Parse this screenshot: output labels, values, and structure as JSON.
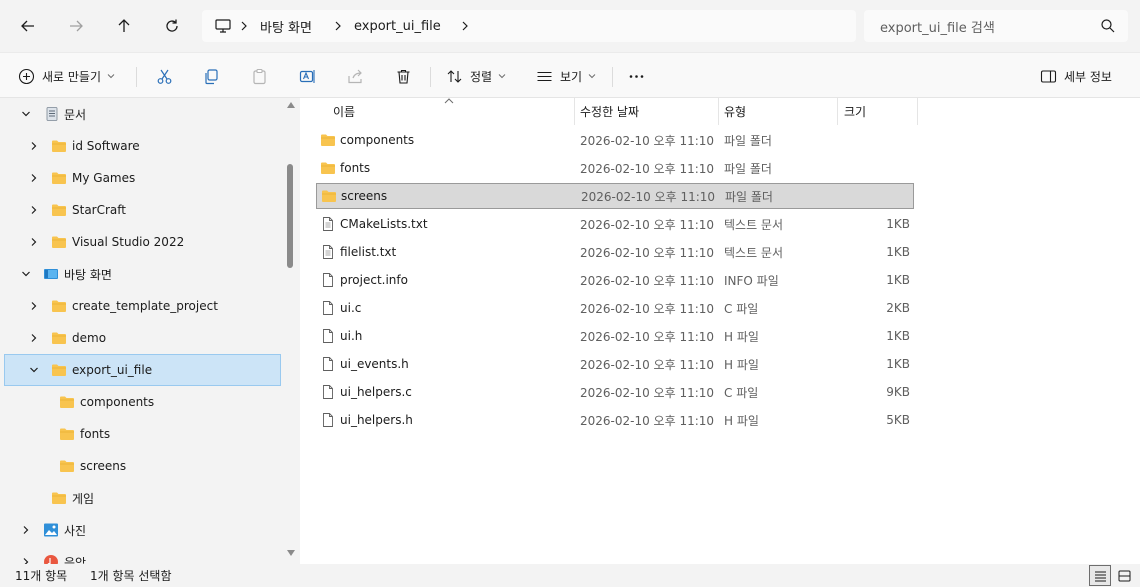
{
  "address": {
    "crumbs": [
      "바탕 화면",
      "export_ui_file"
    ]
  },
  "search": {
    "placeholder": "export_ui_file 검색"
  },
  "toolbar": {
    "new_label": "새로 만들기",
    "sort_label": "정렬",
    "view_label": "보기",
    "details_label": "세부 정보"
  },
  "nav": {
    "items": [
      {
        "label": "문서"
      },
      {
        "label": "id Software"
      },
      {
        "label": "My Games"
      },
      {
        "label": "StarCraft"
      },
      {
        "label": "Visual Studio 2022"
      },
      {
        "label": "바탕 화면"
      },
      {
        "label": "create_template_project"
      },
      {
        "label": "demo"
      },
      {
        "label": "export_ui_file"
      },
      {
        "label": "components"
      },
      {
        "label": "fonts"
      },
      {
        "label": "screens"
      },
      {
        "label": "게임"
      },
      {
        "label": "사진"
      },
      {
        "label": "음악"
      }
    ]
  },
  "columns": {
    "name": "이름",
    "modified": "수정한 날짜",
    "type": "유형",
    "size": "크기"
  },
  "files": [
    {
      "name": "components",
      "modified": "2026-02-10 오후 11:10",
      "type": "파일 폴더",
      "size": ""
    },
    {
      "name": "fonts",
      "modified": "2026-02-10 오후 11:10",
      "type": "파일 폴더",
      "size": ""
    },
    {
      "name": "screens",
      "modified": "2026-02-10 오후 11:10",
      "type": "파일 폴더",
      "size": ""
    },
    {
      "name": "CMakeLists.txt",
      "modified": "2026-02-10 오후 11:10",
      "type": "텍스트 문서",
      "size": "1KB"
    },
    {
      "name": "filelist.txt",
      "modified": "2026-02-10 오후 11:10",
      "type": "텍스트 문서",
      "size": "1KB"
    },
    {
      "name": "project.info",
      "modified": "2026-02-10 오후 11:10",
      "type": "INFO 파일",
      "size": "1KB"
    },
    {
      "name": "ui.c",
      "modified": "2026-02-10 오후 11:10",
      "type": "C 파일",
      "size": "2KB"
    },
    {
      "name": "ui.h",
      "modified": "2026-02-10 오후 11:10",
      "type": "H 파일",
      "size": "1KB"
    },
    {
      "name": "ui_events.h",
      "modified": "2026-02-10 오후 11:10",
      "type": "H 파일",
      "size": "1KB"
    },
    {
      "name": "ui_helpers.c",
      "modified": "2026-02-10 오후 11:10",
      "type": "C 파일",
      "size": "9KB"
    },
    {
      "name": "ui_helpers.h",
      "modified": "2026-02-10 오후 11:10",
      "type": "H 파일",
      "size": "5KB"
    }
  ],
  "status": {
    "count": "11개 항목",
    "selected": "1개 항목 선택함"
  },
  "colors": {
    "folder": "#f8c44f",
    "nav_selected": "#cce4f7",
    "row_selected": "#d9d9d9"
  }
}
